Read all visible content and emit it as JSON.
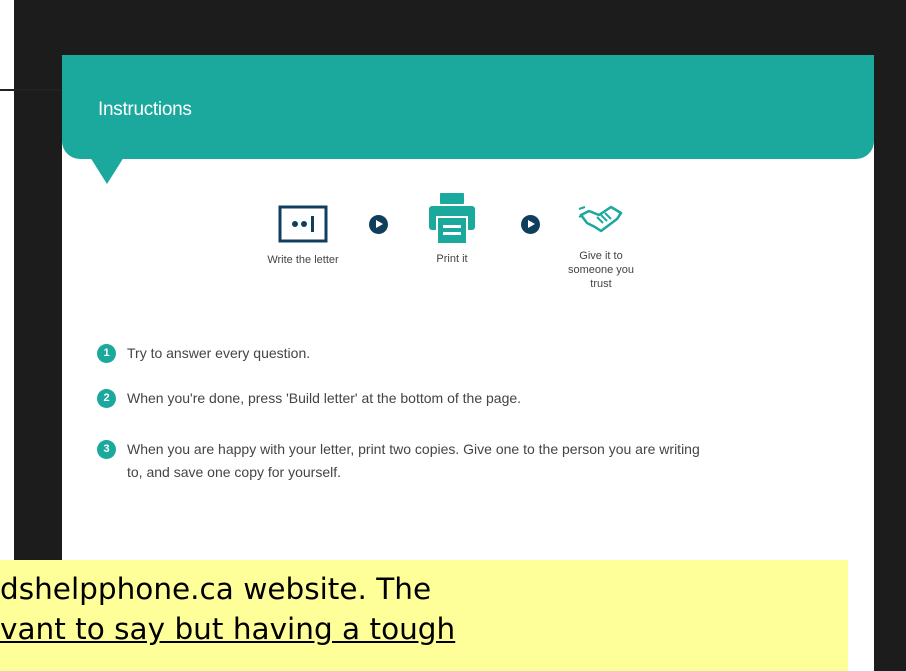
{
  "modal": {
    "title": "Instructions",
    "steps": [
      {
        "icon": "letter-icon",
        "label": "Write the letter"
      },
      {
        "icon": "printer-icon",
        "label": "Print it"
      },
      {
        "icon": "handshake-icon",
        "label": "Give it to someone you trust"
      }
    ],
    "instructions": [
      {
        "number": "1",
        "text": "Try to answer every question."
      },
      {
        "number": "2",
        "text": "When you're done, press 'Build letter' at the bottom of the page."
      },
      {
        "number": "3",
        "text": "When you are happy with your letter, print two copies. Give one to the person you are writing to, and save one copy for yourself."
      }
    ]
  },
  "caption": {
    "line1": "dshelpphone.ca website.  The",
    "line2": "vant to say but having a tough"
  },
  "colors": {
    "teal": "#1ba89d",
    "navy": "#0f3f5c",
    "caption_bg": "#ffff99",
    "frame": "#1c1c1c"
  }
}
